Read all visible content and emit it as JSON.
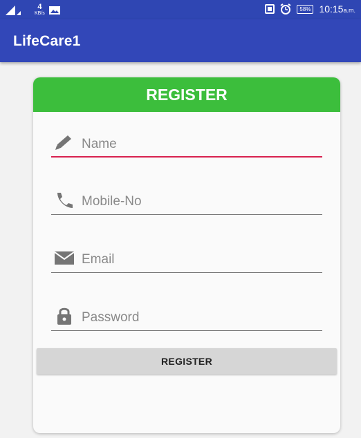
{
  "status_bar": {
    "network_label": "4",
    "speed_label": "KB/s",
    "time": "10:15",
    "ampm": "a.m.",
    "battery": "58%",
    "icons": [
      "signal-icon",
      "image-icon",
      "cast-icon",
      "alarm-icon",
      "battery-icon"
    ]
  },
  "app_bar": {
    "title": "LifeCare1",
    "color": "#3247b8"
  },
  "card": {
    "header": "REGISTER",
    "header_color": "#3cbe3c",
    "fields": {
      "name": {
        "placeholder": "Name",
        "icon": "pencil-icon"
      },
      "mobile": {
        "placeholder": "Mobile-No",
        "icon": "phone-icon"
      },
      "email": {
        "placeholder": "Email",
        "icon": "mail-icon"
      },
      "password": {
        "placeholder": "Password",
        "icon": "lock-icon"
      }
    },
    "register_button": "REGISTER"
  }
}
